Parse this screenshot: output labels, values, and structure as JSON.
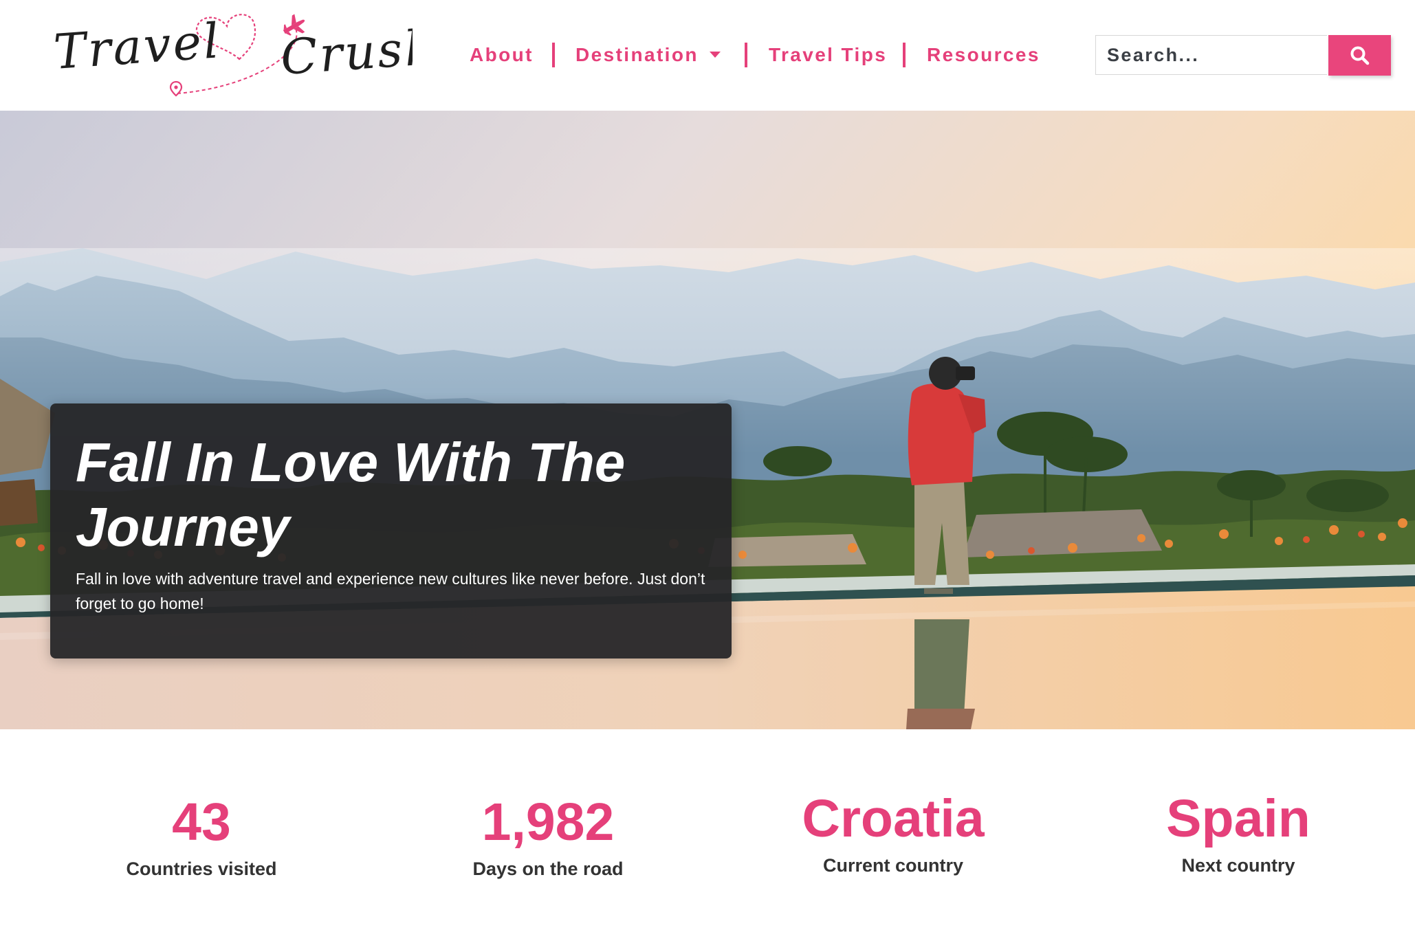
{
  "brand": {
    "logo_text_1": "Travel",
    "logo_text_2": "Crush",
    "logo_icon": "heart-airplane-route",
    "accent_color": "#e5407a"
  },
  "nav": {
    "items": [
      {
        "label": "About"
      },
      {
        "label": "Destination",
        "has_dropdown": true
      },
      {
        "label": "Travel Tips"
      },
      {
        "label": "Resources"
      }
    ]
  },
  "search": {
    "placeholder": "Search...",
    "button_icon": "search-icon"
  },
  "hero": {
    "title": "Fall In Love With The Journey",
    "text": "Fall in love with adventure travel and experience new cultures like never before. Just don’t forget to go home!"
  },
  "stats": [
    {
      "value": "43",
      "label": "Countries visited"
    },
    {
      "value": "1,982",
      "label": "Days on the road"
    },
    {
      "value": "Croatia",
      "label": "Current country"
    },
    {
      "value": "Spain",
      "label": "Next country"
    }
  ]
}
